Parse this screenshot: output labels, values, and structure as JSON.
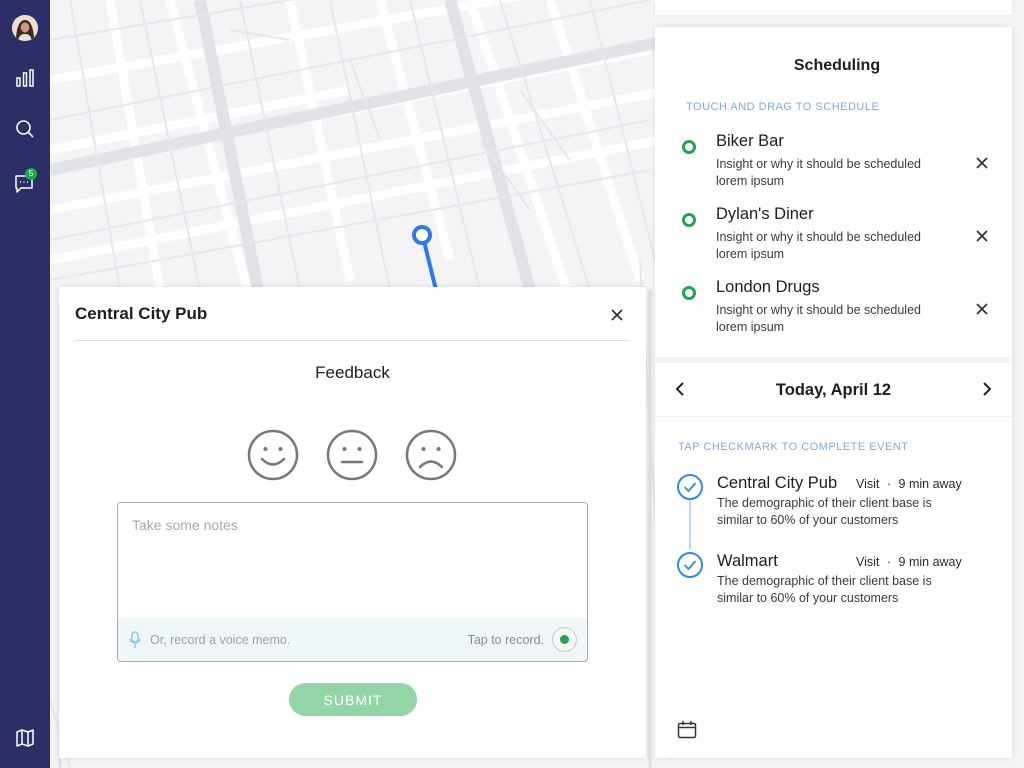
{
  "sidebar": {
    "items": [
      {
        "name": "avatar",
        "icon": "avatar"
      },
      {
        "name": "analytics",
        "icon": "bar-chart-icon"
      },
      {
        "name": "search",
        "icon": "search-icon"
      },
      {
        "name": "messages",
        "icon": "chat-icon",
        "badge": "5"
      },
      {
        "name": "map",
        "icon": "map-icon"
      }
    ]
  },
  "map": {
    "route_color": "#2f78e8"
  },
  "feedback": {
    "title": "Central City Pub",
    "heading": "Feedback",
    "faces": [
      "happy-face-icon",
      "neutral-face-icon",
      "sad-face-icon"
    ],
    "notes_placeholder": "Take some notes",
    "voice_placeholder": "Or, record a voice memo.",
    "tap_record": "Tap to record.",
    "submit_label": "SUBMIT"
  },
  "scheduling": {
    "title": "Scheduling",
    "instruction": "TOUCH AND DRAG TO SCHEDULE",
    "items": [
      {
        "name": "Biker Bar",
        "description": "Insight or why it should be scheduled lorem ipsum"
      },
      {
        "name": "Dylan's Diner",
        "description": "Insight or why it should be scheduled lorem ipsum"
      },
      {
        "name": "London Drugs",
        "description": "Insight or why it should be scheduled lorem ipsum"
      }
    ]
  },
  "events": {
    "date": "Today, April 12",
    "instruction": "TAP CHECKMARK TO COMPLETE EVENT",
    "items": [
      {
        "name": "Central City Pub",
        "type": "Visit",
        "separator": "·",
        "distance": "9 min away",
        "description": "The demographic of their client base is similar to 60% of your customers"
      },
      {
        "name": "Walmart",
        "type": "Visit",
        "separator": "·",
        "distance": "9 min away",
        "description": "The demographic of their client base is similar to 60% of your customers"
      }
    ]
  },
  "colors": {
    "sidebar": "#2c2f66",
    "accent_green": "#1fa552",
    "accent_blue": "#2f8ae0",
    "label_blue": "#7fa9d9"
  }
}
